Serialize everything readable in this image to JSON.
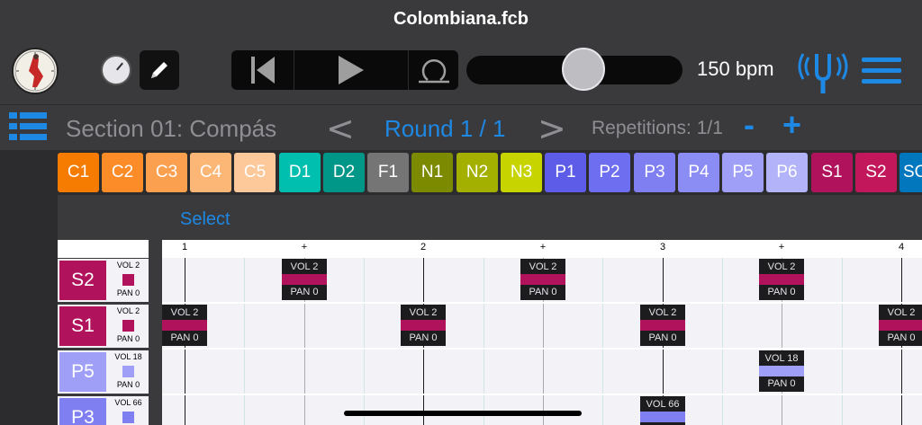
{
  "window": {
    "title": "Colombiana.fcb"
  },
  "toolbar": {
    "bpm": "150 bpm",
    "tempo_fraction": 0.55
  },
  "section": {
    "title": "Section 01: Compás",
    "prev": "<",
    "round": "Round 1 / 1",
    "next": ">",
    "repetitions": "Repetitions: 1/1",
    "minus": "-",
    "plus": "+"
  },
  "tabs": [
    {
      "label": "C1",
      "color": "#f57c00"
    },
    {
      "label": "C2",
      "color": "#fb8c28"
    },
    {
      "label": "C3",
      "color": "#fba04e"
    },
    {
      "label": "C4",
      "color": "#fcb676"
    },
    {
      "label": "C5",
      "color": "#fdc89a"
    },
    {
      "label": "D1",
      "color": "#00bfae"
    },
    {
      "label": "D2",
      "color": "#009688"
    },
    {
      "label": "F1",
      "color": "#757575"
    },
    {
      "label": "N1",
      "color": "#7c8a00"
    },
    {
      "label": "N2",
      "color": "#a4b000"
    },
    {
      "label": "N3",
      "color": "#c8d400"
    },
    {
      "label": "P1",
      "color": "#5c5ce8"
    },
    {
      "label": "P2",
      "color": "#6e6ef0"
    },
    {
      "label": "P3",
      "color": "#7f7ff2"
    },
    {
      "label": "P4",
      "color": "#8c8cf5"
    },
    {
      "label": "P5",
      "color": "#9f9ff7"
    },
    {
      "label": "P6",
      "color": "#b3b3f9"
    },
    {
      "label": "S1",
      "color": "#b0125b"
    },
    {
      "label": "S2",
      "color": "#c2185b"
    },
    {
      "label": "SO",
      "color": "#0277bd"
    }
  ],
  "select_label": "Select",
  "ruler": [
    "1",
    "+",
    "2",
    "+",
    "3",
    "+",
    "4"
  ],
  "rows": [
    {
      "tag": "S2",
      "vol": "VOL 2",
      "pan": "PAN 0",
      "color": "#b0125b"
    },
    {
      "tag": "S1",
      "vol": "VOL 2",
      "pan": "PAN 0",
      "color": "#b0125b"
    },
    {
      "tag": "P5",
      "vol": "VOL 18",
      "pan": "PAN 0",
      "color": "#9f9ff7"
    },
    {
      "tag": "P3",
      "vol": "VOL 66",
      "pan": "",
      "color": "#7f7ff2"
    }
  ],
  "notes": [
    {
      "vol": "VOL 2",
      "pan": "PAN 0",
      "color": "#b0125b"
    },
    {
      "vol": "VOL 2",
      "pan": "PAN 0",
      "color": "#b0125b"
    },
    {
      "vol": "VOL 2",
      "pan": "PAN 0",
      "color": "#b0125b"
    },
    {
      "vol": "VOL 2",
      "pan": "PAN 0",
      "color": "#b0125b"
    },
    {
      "vol": "VOL 2",
      "pan": "PAN 0",
      "color": "#b0125b"
    },
    {
      "vol": "VOL 2",
      "pan": "PAN 0",
      "color": "#b0125b"
    },
    {
      "vol": "VOL 2",
      "pan": "PAN 0",
      "color": "#b0125b"
    },
    {
      "vol": "VOL 18",
      "pan": "PAN 0",
      "color": "#9f9ff7"
    },
    {
      "vol": "VOL 66",
      "pan": "",
      "color": "#7f7ff2"
    }
  ]
}
